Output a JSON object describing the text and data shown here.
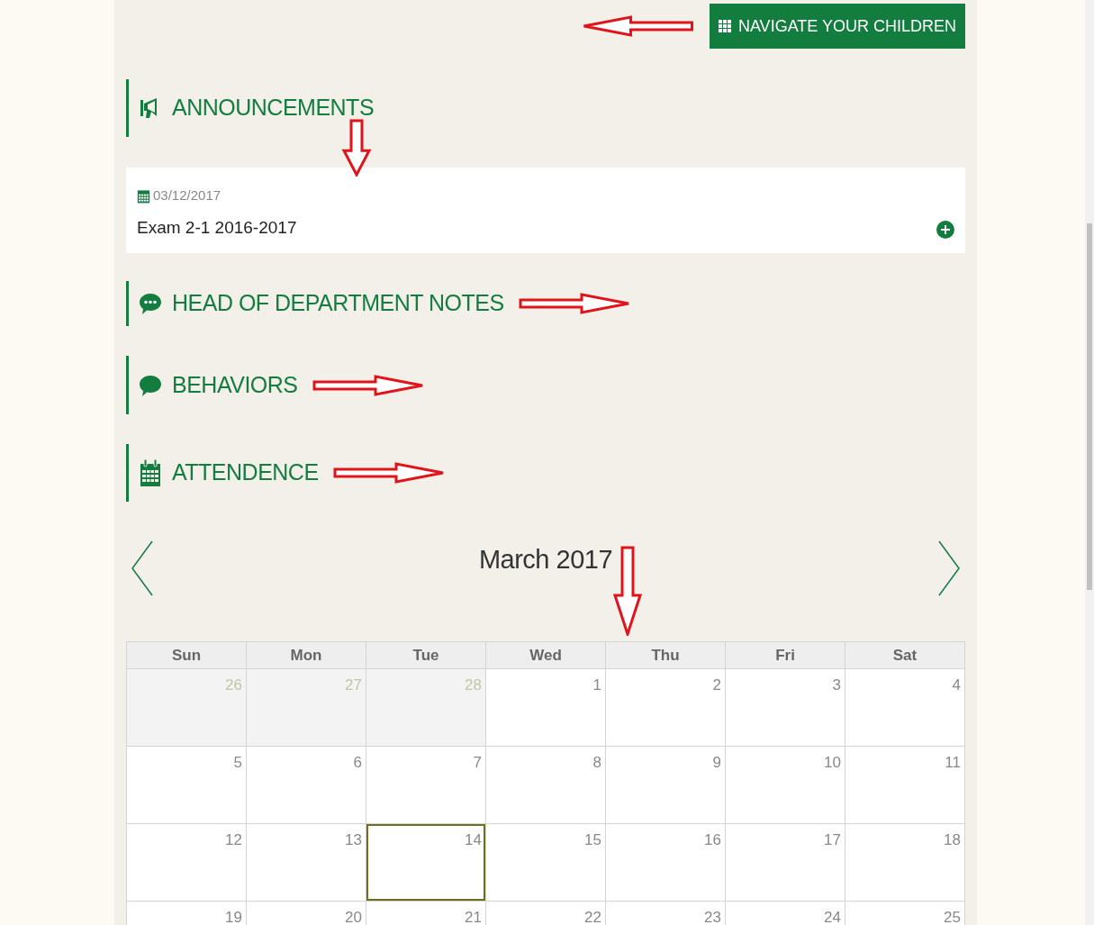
{
  "nav_button": {
    "label": "NAVIGATE YOUR CHILDREN"
  },
  "sections": [
    {
      "kind": "announcements",
      "title": "ANNOUNCEMENTS",
      "items": [
        {
          "date": "03/12/2017",
          "title": "Exam 2-1 2016-2017"
        }
      ]
    },
    {
      "kind": "notes",
      "title": "HEAD OF DEPARTMENT NOTES"
    },
    {
      "kind": "behaviors",
      "title": "BEHAVIORS"
    },
    {
      "kind": "attendance",
      "title": "ATTENDENCE"
    }
  ],
  "calendar": {
    "title": "March 2017",
    "weekdays": [
      "Sun",
      "Mon",
      "Tue",
      "Wed",
      "Thu",
      "Fri",
      "Sat"
    ],
    "weeks": [
      [
        {
          "day": "26",
          "other_month": true,
          "selected": false
        },
        {
          "day": "27",
          "other_month": true,
          "selected": false
        },
        {
          "day": "28",
          "other_month": true,
          "selected": false
        },
        {
          "day": "1",
          "other_month": false,
          "selected": false
        },
        {
          "day": "2",
          "other_month": false,
          "selected": false
        },
        {
          "day": "3",
          "other_month": false,
          "selected": false
        },
        {
          "day": "4",
          "other_month": false,
          "selected": false
        }
      ],
      [
        {
          "day": "5",
          "other_month": false,
          "selected": false
        },
        {
          "day": "6",
          "other_month": false,
          "selected": false
        },
        {
          "day": "7",
          "other_month": false,
          "selected": false
        },
        {
          "day": "8",
          "other_month": false,
          "selected": false
        },
        {
          "day": "9",
          "other_month": false,
          "selected": false
        },
        {
          "day": "10",
          "other_month": false,
          "selected": false
        },
        {
          "day": "11",
          "other_month": false,
          "selected": false
        }
      ],
      [
        {
          "day": "12",
          "other_month": false,
          "selected": false
        },
        {
          "day": "13",
          "other_month": false,
          "selected": false
        },
        {
          "day": "14",
          "other_month": false,
          "selected": true
        },
        {
          "day": "15",
          "other_month": false,
          "selected": false
        },
        {
          "day": "16",
          "other_month": false,
          "selected": false
        },
        {
          "day": "17",
          "other_month": false,
          "selected": false
        },
        {
          "day": "18",
          "other_month": false,
          "selected": false
        }
      ],
      [
        {
          "day": "19",
          "other_month": false,
          "selected": false
        },
        {
          "day": "20",
          "other_month": false,
          "selected": false
        },
        {
          "day": "21",
          "other_month": false,
          "selected": false
        },
        {
          "day": "22",
          "other_month": false,
          "selected": false
        },
        {
          "day": "23",
          "other_month": false,
          "selected": false
        },
        {
          "day": "24",
          "other_month": false,
          "selected": false
        },
        {
          "day": "25",
          "other_month": false,
          "selected": false
        }
      ]
    ]
  }
}
